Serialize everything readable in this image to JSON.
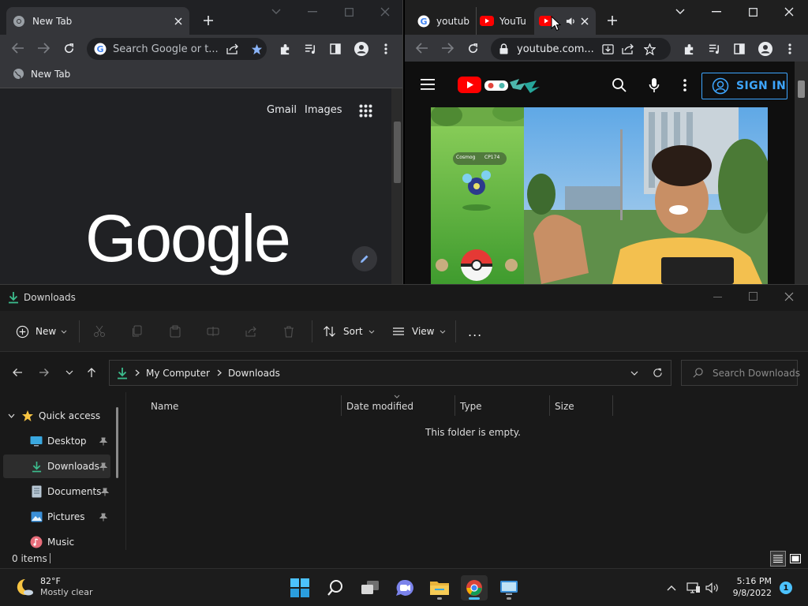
{
  "left_chrome": {
    "tab_title": "New Tab",
    "omnibox_placeholder": "Search Google or t...",
    "bookmark_label": "New Tab",
    "ntp_links": [
      "Gmail",
      "Images"
    ],
    "logo_text": "Google"
  },
  "right_chrome": {
    "tabs": [
      {
        "title": "youtub"
      },
      {
        "title": "YouTu"
      },
      {
        "title": ""
      }
    ],
    "url": "youtube.com...",
    "sign_in_label": "SIGN IN",
    "video": {
      "pokemon_name": "Cosmog",
      "cp_value": "CP174"
    }
  },
  "explorer": {
    "title": "Downloads",
    "commands": {
      "new_label": "New",
      "sort_label": "Sort",
      "view_label": "View",
      "more_label": "..."
    },
    "breadcrumb": [
      "My Computer",
      "Downloads"
    ],
    "search_placeholder": "Search Downloads",
    "nav": [
      {
        "label": "Quick access"
      },
      {
        "label": "Desktop"
      },
      {
        "label": "Downloads"
      },
      {
        "label": "Documents"
      },
      {
        "label": "Pictures"
      },
      {
        "label": "Music"
      }
    ],
    "columns": [
      "Name",
      "Date modified",
      "Type",
      "Size"
    ],
    "empty_message": "This folder is empty.",
    "status_items": "0 items"
  },
  "taskbar": {
    "weather": {
      "temp": "82°F",
      "condition": "Mostly clear"
    },
    "time": "5:16 PM",
    "date": "9/8/2022",
    "notification_count": "1",
    "apps": [
      "windows-start-icon",
      "search-icon",
      "task-view-icon",
      "chat-icon",
      "file-explorer-icon",
      "chrome-icon",
      "remote-desktop-icon"
    ]
  },
  "colors": {
    "chrome_dark": "#202124",
    "youtube_red": "#ff0000",
    "sign_in_blue": "#3ea6ff",
    "explorer_bg": "#191919",
    "taskbar_bg": "#1c1c1c",
    "accent_blue": "#4cc2ff"
  }
}
